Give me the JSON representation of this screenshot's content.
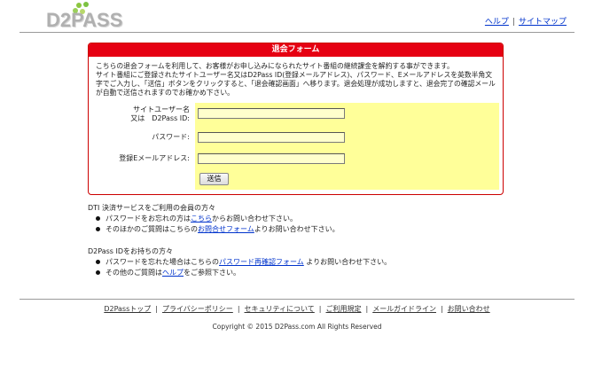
{
  "brand": {
    "logo_text": "D2PASS",
    "dot_colors": [
      "#7dc242",
      "#b8d86b",
      "#4caf50",
      "#9bcf5c"
    ]
  },
  "header": {
    "help_label": "ヘルプ",
    "separator": "|",
    "sitemap_label": "サイトマップ"
  },
  "form_panel": {
    "title": "退会フォーム",
    "description": "こちらの退会フォームを利用して、お客様がお申し込みになられたサイト番組の継続課金を解約する事ができます。\nサイト番組にご登録されたサイトユーザー名又はD2Pass ID(登録メールアドレス)、パスワード、Eメールアドレスを英数半角文字でご入力し、「送信」ボタンをクリックすると、「退会確認画面」へ移ります。退会処理が成功しますと、退会完了の確認メールが自動で送信されますのでお確かめ下さい。",
    "fields": [
      {
        "label": "サイトユーザー名\n又は　D2Pass ID:",
        "value": ""
      },
      {
        "label": "パスワード:",
        "value": ""
      },
      {
        "label": "登録Eメールアドレス:",
        "value": ""
      }
    ],
    "submit_label": "送信"
  },
  "dti_section": {
    "heading": "DTI 決済サービスをご利用の会員の方々",
    "items": [
      {
        "before": "パスワードをお忘れの方は",
        "link": "こちら",
        "after": "からお問い合わせ下さい。"
      },
      {
        "before": "そのほかのご質問はこちらの",
        "link": "お問合せフォーム",
        "after": "よりお問い合わせ下さい。"
      }
    ]
  },
  "d2pass_section": {
    "heading": "D2Pass IDをお持ちの方々",
    "items": [
      {
        "before": "パスワードを忘れた場合はこちらの",
        "link": "パスワード再確認フォーム",
        "after": " よりお問い合わせ下さい。"
      },
      {
        "before": "その他のご質問は",
        "link": "ヘルプ",
        "after": "をご参照下さい。"
      }
    ]
  },
  "footer": {
    "links": [
      "D2Passトップ",
      "プライバシーポリシー",
      "セキュリティについて",
      "ご利用規定",
      "メールガイドライン",
      "お問い合わせ"
    ],
    "separator": "|",
    "copyright": "Copyright © 2015 D2Pass.com All Rights Reserved"
  }
}
